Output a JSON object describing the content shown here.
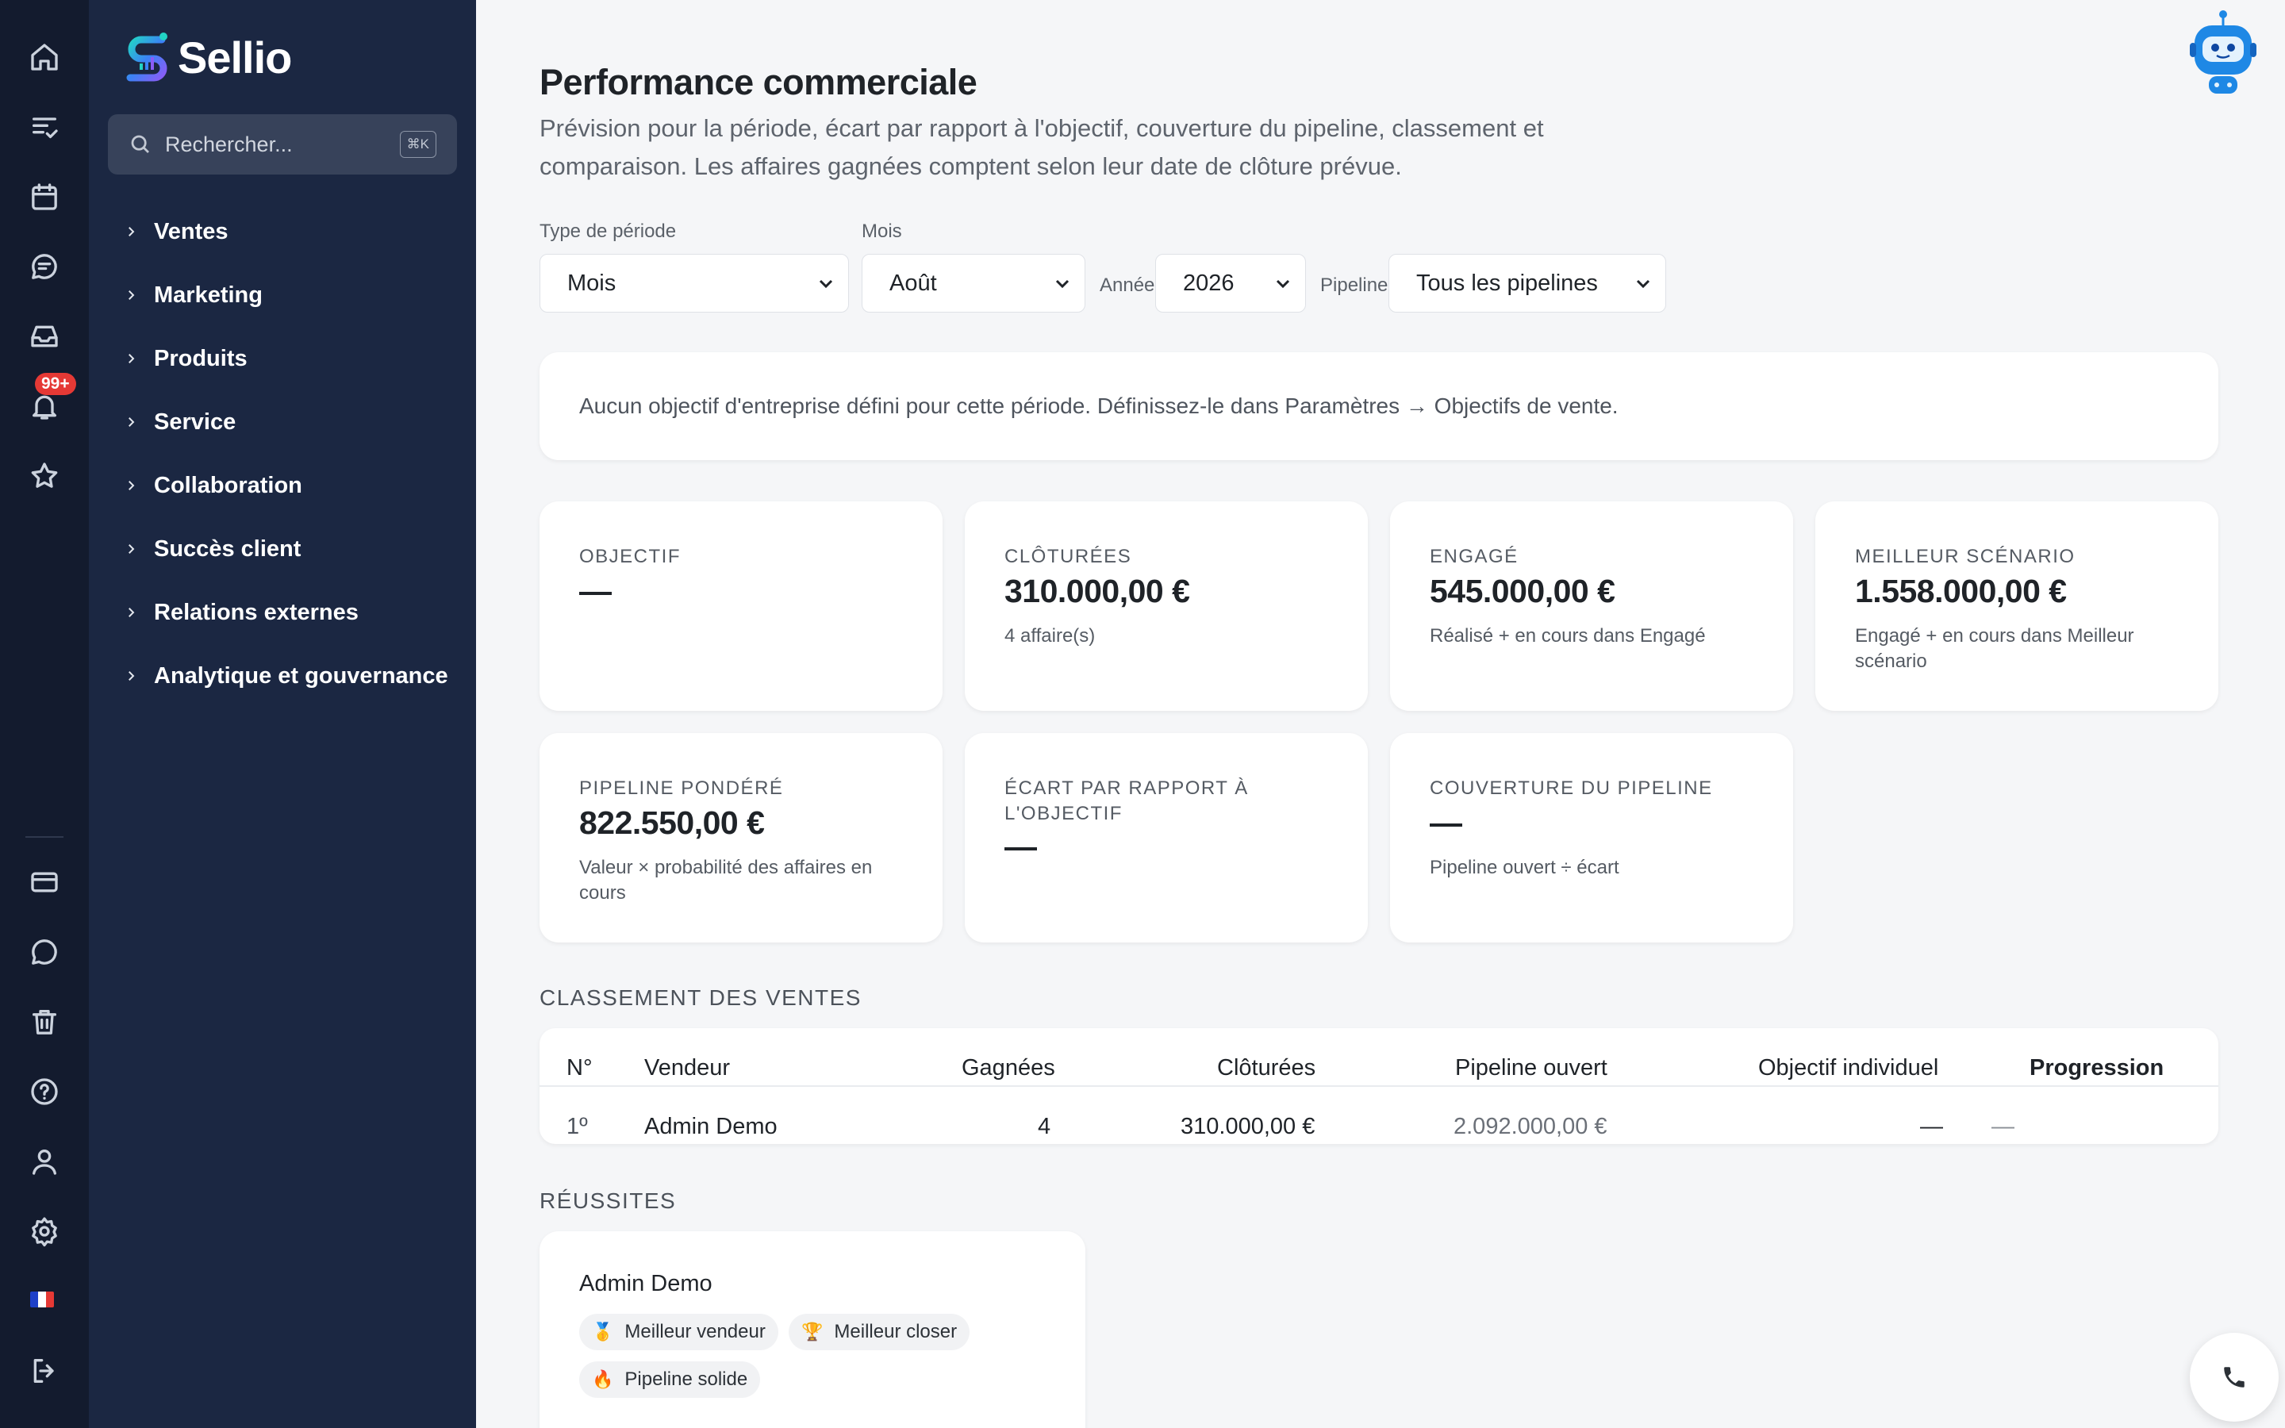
{
  "brand": {
    "name": "Sellio"
  },
  "rail": {
    "notification_badge": "99+"
  },
  "search": {
    "placeholder": "Rechercher...",
    "shortcut": "⌘K"
  },
  "nav": {
    "items": [
      {
        "label": "Ventes"
      },
      {
        "label": "Marketing"
      },
      {
        "label": "Produits"
      },
      {
        "label": "Service"
      },
      {
        "label": "Collaboration"
      },
      {
        "label": "Succès client"
      },
      {
        "label": "Relations externes"
      },
      {
        "label": "Analytique et gouvernance"
      }
    ]
  },
  "page": {
    "title": "Performance commerciale",
    "subtitle": "Prévision pour la période, écart par rapport à l'objectif, couverture du pipeline, classement et comparaison. Les affaires gagnées comptent selon leur date de clôture prévue."
  },
  "filters": {
    "period_type": {
      "label": "Type de période",
      "value": "Mois"
    },
    "month": {
      "label": "Mois",
      "value": "Août"
    },
    "year": {
      "label": "Année",
      "value": "2026"
    },
    "pipeline": {
      "label": "Pipeline",
      "value": "Tous les pipelines"
    }
  },
  "alert": {
    "text": "Aucun objectif d'entreprise défini pour cette période. Définissez-le dans Paramètres → Objectifs de vente."
  },
  "kpis": {
    "objectif": {
      "label": "OBJECTIF",
      "value": "—"
    },
    "cloturees": {
      "label": "CLÔTURÉES",
      "value": "310.000,00 €",
      "note": "4 affaire(s)"
    },
    "engage": {
      "label": "ENGAGÉ",
      "value": "545.000,00 €",
      "note": "Réalisé + en cours dans Engagé"
    },
    "meilleur": {
      "label": "MEILLEUR SCÉNARIO",
      "value": "1.558.000,00 €",
      "note": "Engagé + en cours dans Meilleur scénario"
    },
    "pondere": {
      "label": "PIPELINE PONDÉRÉ",
      "value": "822.550,00 €",
      "note": "Valeur × probabilité des affaires en cours"
    },
    "ecart": {
      "label": "ÉCART PAR RAPPORT À L'OBJECTIF",
      "value": "—"
    },
    "couverture": {
      "label": "COUVERTURE DU PIPELINE",
      "value": "—",
      "note": "Pipeline ouvert ÷ écart"
    }
  },
  "leaderboard": {
    "title": "CLASSEMENT DES VENTES",
    "headers": {
      "rank": "N°",
      "seller": "Vendeur",
      "won": "Gagnées",
      "closed": "Clôturées",
      "open": "Pipeline ouvert",
      "target": "Objectif individuel",
      "progress": "Progression"
    },
    "rows": [
      {
        "rank": "1º",
        "seller": "Admin Demo",
        "won": "4",
        "closed": "310.000,00 €",
        "open": "2.092.000,00 €",
        "target": "—",
        "progress": "—"
      }
    ]
  },
  "achievements": {
    "title": "RÉUSSITES",
    "cards": [
      {
        "name": "Admin Demo",
        "badges": [
          {
            "emoji": "🥇",
            "label": "Meilleur vendeur"
          },
          {
            "emoji": "🏆",
            "label": "Meilleur closer"
          },
          {
            "emoji": "🔥",
            "label": "Pipeline solide"
          }
        ]
      }
    ]
  },
  "colors": {
    "rail_bg": "#131b2e",
    "sidebar_bg": "#1b2742",
    "badge": "#e53935",
    "accent_blue": "#1e88e5",
    "logo_teal": "#22d3c5"
  }
}
